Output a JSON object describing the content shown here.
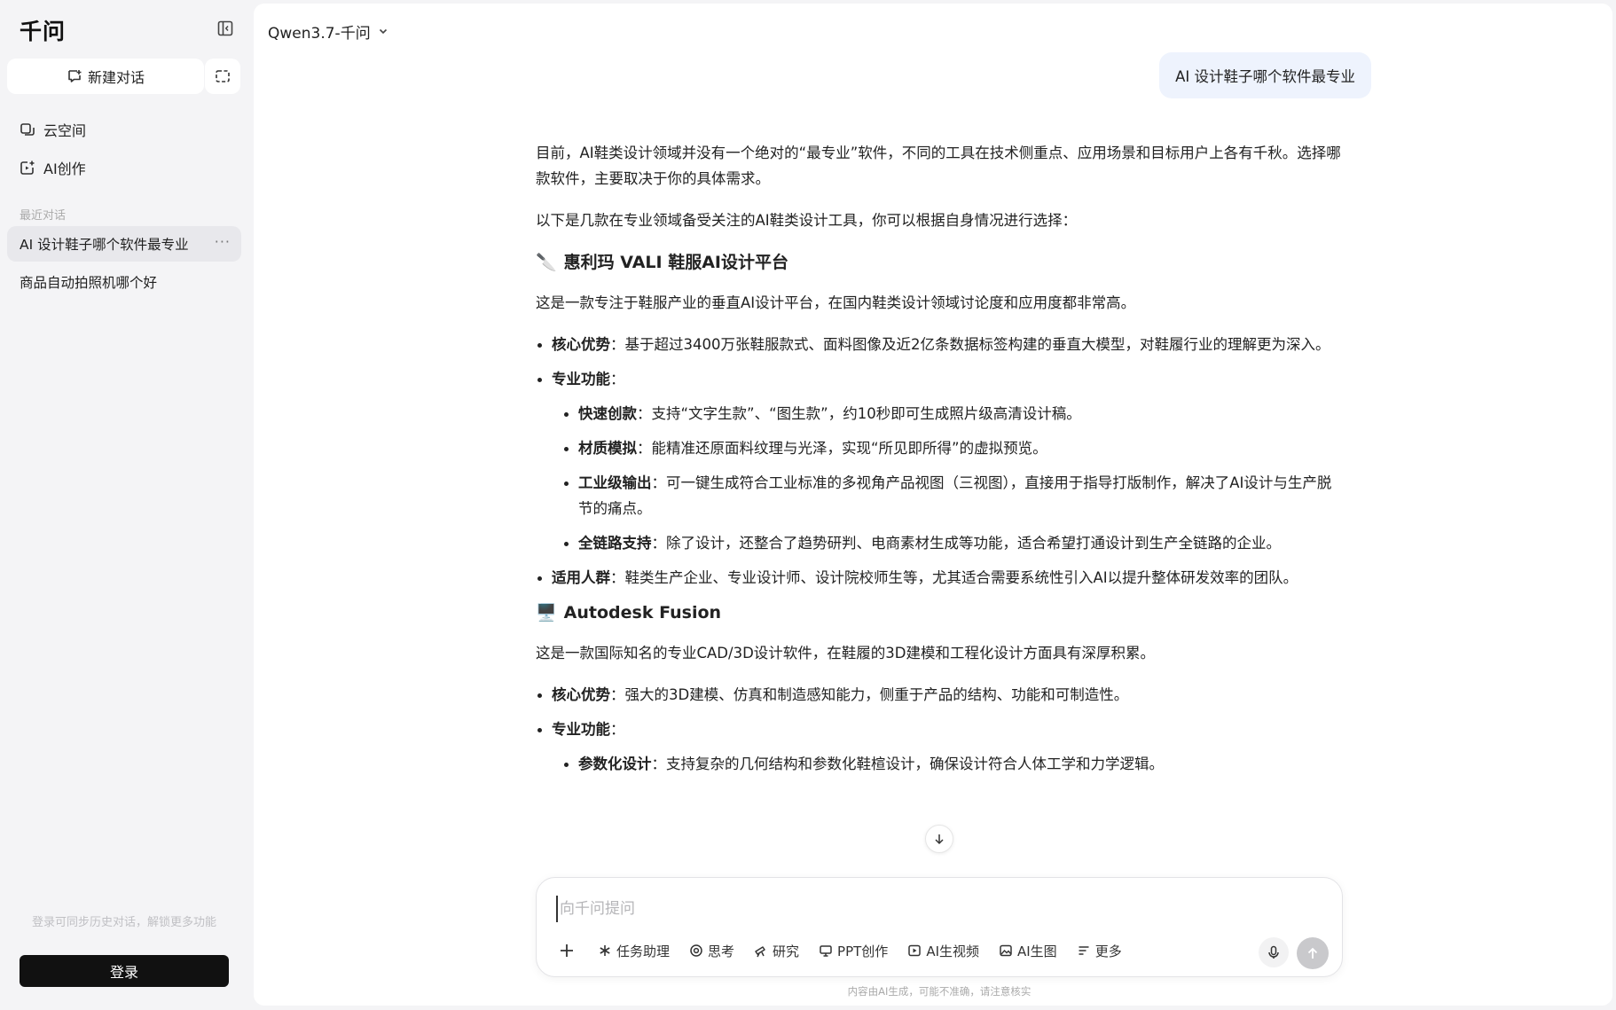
{
  "app": {
    "logo": "千问"
  },
  "sidebar": {
    "new_chat_label": "新建对话",
    "nav": [
      {
        "label": "云空间",
        "icon": "cloud-space-icon"
      },
      {
        "label": "AI创作",
        "icon": "ai-create-icon"
      }
    ],
    "recent_label": "最近对话",
    "conversations": [
      {
        "title": "AI 设计鞋子哪个软件最专业",
        "active": true,
        "more": "···"
      },
      {
        "title": "商品自动拍照机哪个好",
        "active": false
      }
    ],
    "sync_hint": "登录可同步历史对话，解锁更多功能",
    "login_label": "登录"
  },
  "header": {
    "model": "Qwen3.7-千问"
  },
  "chat": {
    "user_message": "AI 设计鞋子哪个软件最专业",
    "answer": {
      "intro1": "目前，AI鞋类设计领域并没有一个绝对的“最专业”软件，不同的工具在技术侧重点、应用场景和目标用户上各有千秋。选择哪款软件，主要取决于你的具体需求。",
      "intro2": "以下是几款在专业领域备受关注的AI鞋类设计工具，你可以根据自身情况进行选择：",
      "s1": {
        "emoji": "🔪",
        "title": "惠利玛 VALI 鞋服AI设计平台",
        "desc": "这是一款专注于鞋服产业的垂直AI设计平台，在国内鞋类设计领域讨论度和应用度都非常高。",
        "adv_label": "核心优势",
        "adv_text": "：基于超过3400万张鞋服款式、面料图像及近2亿条数据标签构建的垂直大模型，对鞋履行业的理解更为深入。",
        "func_label": "专业功能",
        "func_colon": "：",
        "f1_label": "快速创款",
        "f1_text": "：支持“文字生款”、“图生款”，约10秒即可生成照片级高清设计稿。",
        "f2_label": "材质模拟",
        "f2_text": "：能精准还原面料纹理与光泽，实现“所见即所得”的虚拟预览。",
        "f3_label": "工业级输出",
        "f3_text": "：可一键生成符合工业标准的多视角产品视图（三视图），直接用于指导打版制作，解决了AI设计与生产脱节的痛点。",
        "f4_label": "全链路支持",
        "f4_text": "：除了设计，还整合了趋势研判、电商素材生成等功能，适合希望打通设计到生产全链路的企业。",
        "users_label": "适用人群",
        "users_text": "：鞋类生产企业、专业设计师、设计院校师生等，尤其适合需要系统性引入AI以提升整体研发效率的团队。"
      },
      "s2": {
        "emoji": "🖥️",
        "title": "Autodesk Fusion",
        "desc": "这是一款国际知名的专业CAD/3D设计软件，在鞋履的3D建模和工程化设计方面具有深厚积累。",
        "adv_label": "核心优势",
        "adv_text": "：强大的3D建模、仿真和制造感知能力，侧重于产品的结构、功能和可制造性。",
        "func_label": "专业功能",
        "func_colon": "：",
        "f1_label": "参数化设计",
        "f1_text": "：支持复杂的几何结构和参数化鞋楦设计，确保设计符合人体工学和力学逻辑。"
      }
    }
  },
  "composer": {
    "placeholder": "向千问提问",
    "tools": [
      {
        "label": "任务助理",
        "icon": "asterisk-icon"
      },
      {
        "label": "思考",
        "icon": "think-icon"
      },
      {
        "label": "研究",
        "icon": "research-icon"
      },
      {
        "label": "PPT创作",
        "icon": "ppt-icon"
      },
      {
        "label": "AI生视频",
        "icon": "video-icon"
      },
      {
        "label": "AI生图",
        "icon": "image-icon"
      },
      {
        "label": "更多",
        "icon": "more-lines-icon"
      }
    ]
  },
  "disclaimer": "内容由AI生成，可能不准确，请注意核实"
}
